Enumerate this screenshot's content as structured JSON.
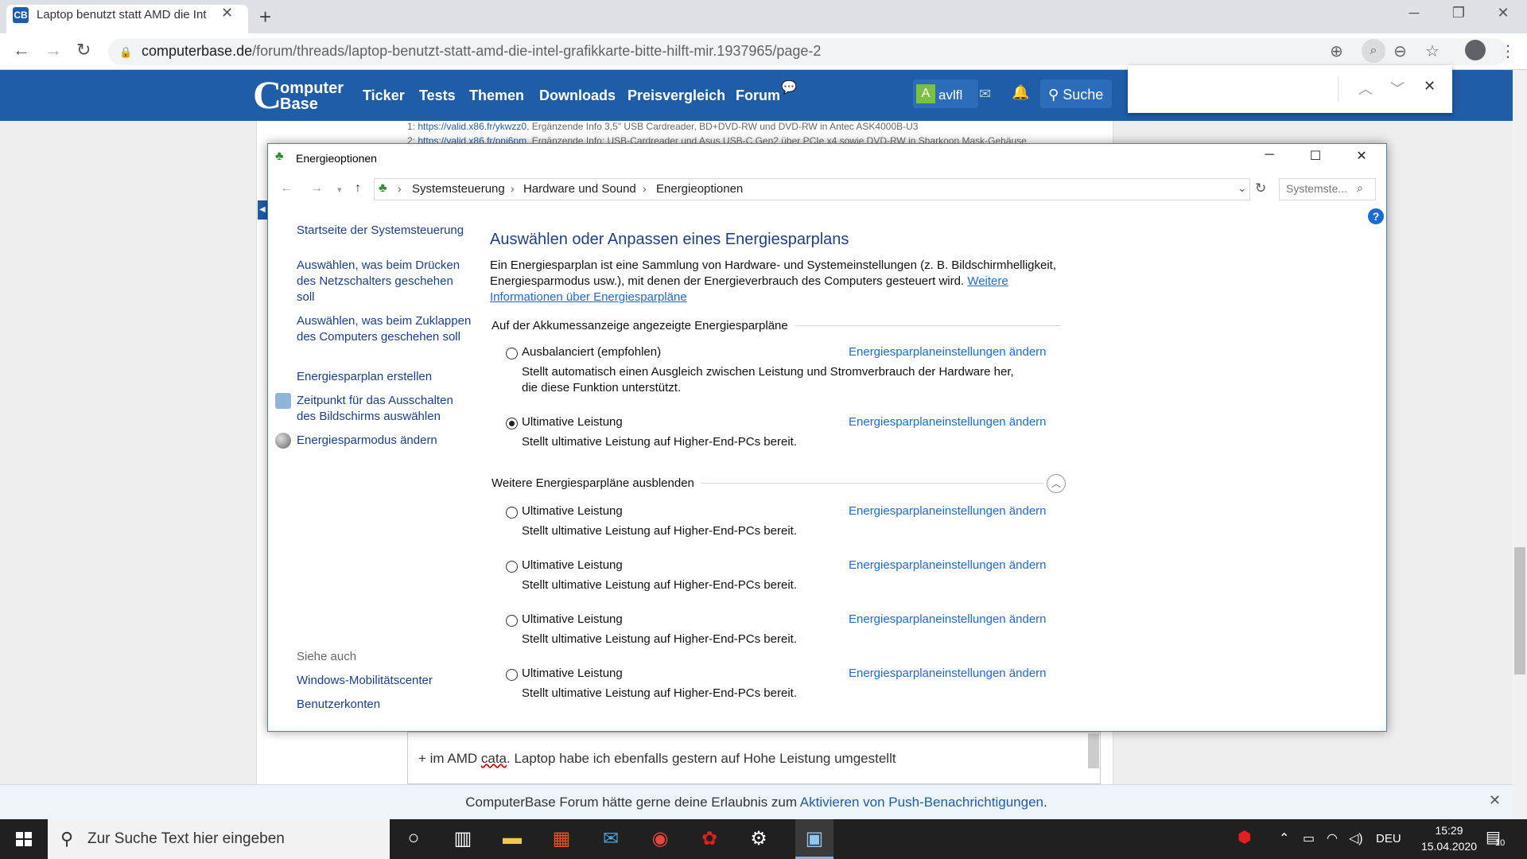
{
  "browser": {
    "tab_title": "Laptop benutzt statt AMD die Int",
    "tab_favicon": "CB",
    "new_tab": "+",
    "url_host": "computerbase.de",
    "url_path": "/forum/threads/laptop-benutzt-statt-amd-die-intel-grafikkarte-bitte-hilft-mir.1937965/page-2"
  },
  "site": {
    "logo_c": "C",
    "logo_line1": "omputer",
    "logo_line2": "Base",
    "nav": [
      "Ticker",
      "Tests",
      "Themen",
      "Downloads",
      "Preisvergleich",
      "Forum"
    ],
    "avatar_letter": "A",
    "username": "avlfl",
    "search_label": "Suche",
    "accent": "#1f5da8"
  },
  "page": {
    "sig1_num": "1:",
    "sig1_link": "https://valid.x86.fr/ykwzz0",
    "sig1_text": ", Ergänzende Info 3,5\" USB Cardreader, BD+DVD-RW und DVD-RW in Antec ASK4000B-U3",
    "sig2_num": "2:",
    "sig2_link": "https://valid.x86.fr/pnj6pm",
    "sig2_text": ", Ergänzende Info: USB-Cardreader und Asus USB-C Gen2 über PCIe x4 sowie DVD-RW in Sharkoon Mask-Gehäuse",
    "post_prefix": "+ im AMD ",
    "post_misspelled": "cata",
    "post_suffix": ". Laptop habe ich ebenfalls gestern auf Hohe Leistung umgestellt",
    "notif_text": "ComputerBase Forum hätte gerne deine Erlaubnis zum ",
    "notif_link": "Aktivieren von Push-Benachrichtigungen",
    "notif_end": "."
  },
  "window": {
    "title": "Energieoptionen",
    "crumbs": [
      "Systemsteuerung",
      "Hardware und Sound",
      "Energieoptionen"
    ],
    "search_placeholder": "Systemste...",
    "help": "?",
    "left_pane": {
      "home": "Startseite der Systemsteuerung",
      "links": [
        "Auswählen, was beim Drücken des Netzschalters geschehen soll",
        "Auswählen, was beim Zuklappen des Computers geschehen soll",
        "Energiesparplan erstellen",
        "Zeitpunkt für das Ausschalten des Bildschirms auswählen",
        "Energiesparmodus ändern"
      ],
      "see_also": "Siehe auch",
      "see_also_links": [
        "Windows-Mobilitätscenter",
        "Benutzerkonten"
      ]
    },
    "main": {
      "heading": "Auswählen oder Anpassen eines Energiesparplans",
      "description": "Ein Energiesparplan ist eine Sammlung von Hardware- und Systemeinstellungen (z. B. Bildschirmhelligkeit, Energiesparmodus usw.), mit denen der Energieverbrauch des Computers gesteuert wird. ",
      "more_info": "Weitere Informationen über Energiesparpläne",
      "group1": "Auf der Akkumessanzeige angezeigte Energiesparpläne",
      "group2": "Weitere Energiesparpläne ausblenden",
      "change_link": "Energiesparplaneinstellungen ändern",
      "plans": [
        {
          "name": "Ausbalanciert (empfohlen)",
          "info": "Stellt automatisch einen Ausgleich zwischen Leistung und Stromverbrauch der Hardware her, die diese Funktion unterstützt.",
          "selected": false
        },
        {
          "name": "Ultimative Leistung",
          "info": "Stellt ultimative Leistung auf Higher-End-PCs bereit.",
          "selected": true
        },
        {
          "name": "Ultimative Leistung",
          "info": "Stellt ultimative Leistung auf Higher-End-PCs bereit.",
          "selected": false
        },
        {
          "name": "Ultimative Leistung",
          "info": "Stellt ultimative Leistung auf Higher-End-PCs bereit.",
          "selected": false
        },
        {
          "name": "Ultimative Leistung",
          "info": "Stellt ultimative Leistung auf Higher-End-PCs bereit.",
          "selected": false
        },
        {
          "name": "Ultimative Leistung",
          "info": "Stellt ultimative Leistung auf Higher-End-PCs bereit.",
          "selected": false
        }
      ]
    }
  },
  "taskbar": {
    "search_placeholder": "Zur Suche Text hier eingeben",
    "language": "DEU",
    "time": "15:29",
    "date": "15.04.2020",
    "notification_count": "10"
  }
}
